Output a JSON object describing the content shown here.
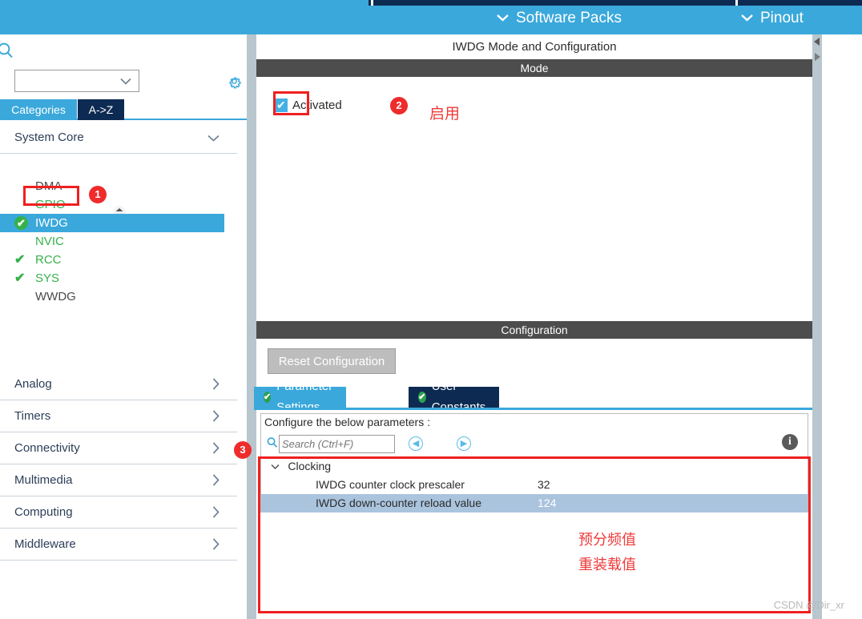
{
  "topbar": {
    "menus": [
      {
        "label": "Software Packs",
        "icon": "chevron-down-icon"
      },
      {
        "label": "Pinout",
        "icon": "chevron-down-icon"
      }
    ],
    "accent_color": "#3aa8db",
    "navy_color": "#0d2b52"
  },
  "sidebar": {
    "search_icon": "search-icon",
    "combo_value": "",
    "combo_icon": "chevron-down-icon",
    "gear_icon": "gear-icon",
    "tabs": [
      {
        "label": "Categories",
        "active": true
      },
      {
        "label": "A->Z",
        "active": false
      }
    ],
    "system_core": {
      "label": "System Core",
      "expand_icon": "chevron-down-icon",
      "items": [
        {
          "label": "DMA",
          "state": "gray",
          "checked": false
        },
        {
          "label": "GPIO",
          "state": "green",
          "checked": false
        },
        {
          "label": "IWDG",
          "state": "selected",
          "checked": true
        },
        {
          "label": "NVIC",
          "state": "green",
          "checked": false
        },
        {
          "label": "RCC",
          "state": "green",
          "checked": true
        },
        {
          "label": "SYS",
          "state": "green",
          "checked": true
        },
        {
          "label": "WWDG",
          "state": "gray",
          "checked": false
        }
      ]
    },
    "categories": [
      {
        "label": "Analog",
        "expand_icon": "chevron-right-icon"
      },
      {
        "label": "Timers",
        "expand_icon": "chevron-right-icon"
      },
      {
        "label": "Connectivity",
        "expand_icon": "chevron-right-icon"
      },
      {
        "label": "Multimedia",
        "expand_icon": "chevron-right-icon"
      },
      {
        "label": "Computing",
        "expand_icon": "chevron-right-icon"
      },
      {
        "label": "Middleware",
        "expand_icon": "chevron-right-icon"
      }
    ]
  },
  "main": {
    "panel_title": "IWDG Mode and Configuration",
    "mode_section": {
      "header": "Mode",
      "checkbox_label": "Activated",
      "checked": true
    },
    "config_section": {
      "header": "Configuration",
      "reset_button": "Reset Configuration",
      "tabs": [
        {
          "label": "Parameter Settings",
          "active": true,
          "icon": "check-circle-icon"
        },
        {
          "label": "User Constants",
          "active": false,
          "icon": "check-circle-icon"
        }
      ],
      "configure_label": "Configure the below parameters :",
      "search_placeholder": "Search (Ctrl+F)",
      "search_value": "",
      "nav_prev_icon": "circle-left-arrow-icon",
      "nav_next_icon": "circle-right-arrow-icon",
      "info_icon": "info-icon",
      "groups": [
        {
          "label": "Clocking",
          "twisty_icon": "chevron-down-icon",
          "rows": [
            {
              "name": "IWDG counter clock prescaler",
              "value": "32",
              "selected": false
            },
            {
              "name": "IWDG down-counter reload value",
              "value": "124",
              "selected": true
            }
          ]
        }
      ]
    }
  },
  "annotations": {
    "badges": [
      {
        "number": "1"
      },
      {
        "number": "2"
      },
      {
        "number": "3"
      }
    ],
    "texts": [
      {
        "text": "启用"
      },
      {
        "text": "预分频值"
      },
      {
        "text": "重装载值"
      }
    ],
    "color": "#f01f1f"
  },
  "watermark": "CSDN @Dir_xr"
}
